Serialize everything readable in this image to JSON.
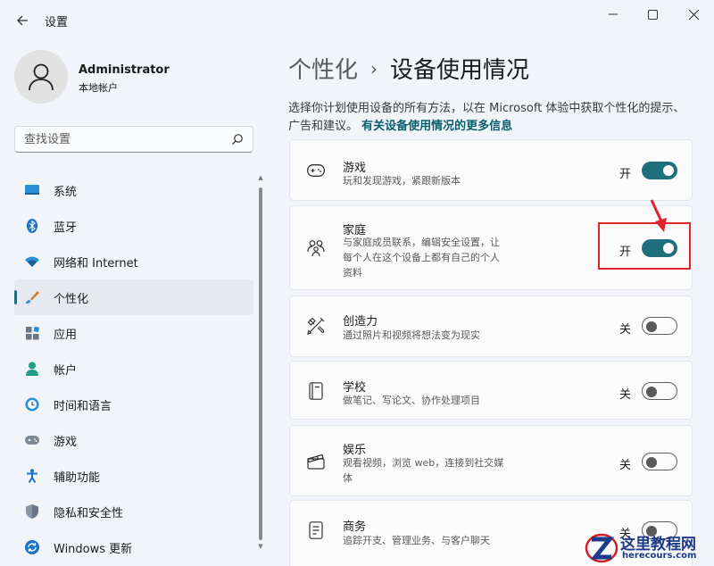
{
  "window": {
    "title": "设置",
    "minimize_icon": "minimize-icon",
    "maximize_icon": "maximize-icon",
    "close_icon": "close-icon"
  },
  "profile": {
    "name": "Administrator",
    "account_type": "本地帐户"
  },
  "search": {
    "placeholder": "查找设置"
  },
  "nav": {
    "items": [
      {
        "label": "系统",
        "icon": "system-icon"
      },
      {
        "label": "蓝牙",
        "icon": "bluetooth-icon"
      },
      {
        "label": "网络和 Internet",
        "icon": "network-icon"
      },
      {
        "label": "个性化",
        "icon": "personalization-icon",
        "active": true
      },
      {
        "label": "应用",
        "icon": "apps-icon"
      },
      {
        "label": "帐户",
        "icon": "account-icon"
      },
      {
        "label": "时间和语言",
        "icon": "time-language-icon"
      },
      {
        "label": "游戏",
        "icon": "gaming-icon"
      },
      {
        "label": "辅助功能",
        "icon": "accessibility-icon"
      },
      {
        "label": "隐私和安全性",
        "icon": "privacy-shield-icon"
      },
      {
        "label": "Windows 更新",
        "icon": "windows-update-icon"
      }
    ]
  },
  "main": {
    "breadcrumb_parent": "个性化",
    "breadcrumb_sep": "›",
    "page_title": "设备使用情况",
    "description": "选择你计划使用设备的所有方法，以在 Microsoft 体验中获取个性化的提示、广告和建议。",
    "description_link": "有关设备使用情况的更多信息",
    "cards": [
      {
        "title": "游戏",
        "subtitle": "玩和发现游戏，紧跟新版本",
        "state_label": "开",
        "on": true
      },
      {
        "title": "家庭",
        "subtitle_lines": [
          "与家庭成员联系，编辑安全设置，让",
          "每个人在这个设备上都有自己的个人",
          "资料"
        ],
        "state_label": "开",
        "on": true
      },
      {
        "title": "创造力",
        "subtitle": "通过照片和视频将想法变为现实",
        "state_label": "关",
        "on": false
      },
      {
        "title": "学校",
        "subtitle": "做笔记、写论文、协作处理项目",
        "state_label": "关",
        "on": false
      },
      {
        "title": "娱乐",
        "subtitle_lines": [
          "观看视频，浏览 web，连接到社交媒",
          "体"
        ],
        "state_label": "关",
        "on": false
      },
      {
        "title": "商务",
        "subtitle": "追踪开支、管理业务、与客户聊天",
        "state_label": "关",
        "on": false
      }
    ]
  },
  "watermark": {
    "title": "这里教程网",
    "url": "herecours.com"
  },
  "colors": {
    "accent": "#1f6e7c",
    "highlight": "#e0222a",
    "background": "#f1f4f9"
  }
}
